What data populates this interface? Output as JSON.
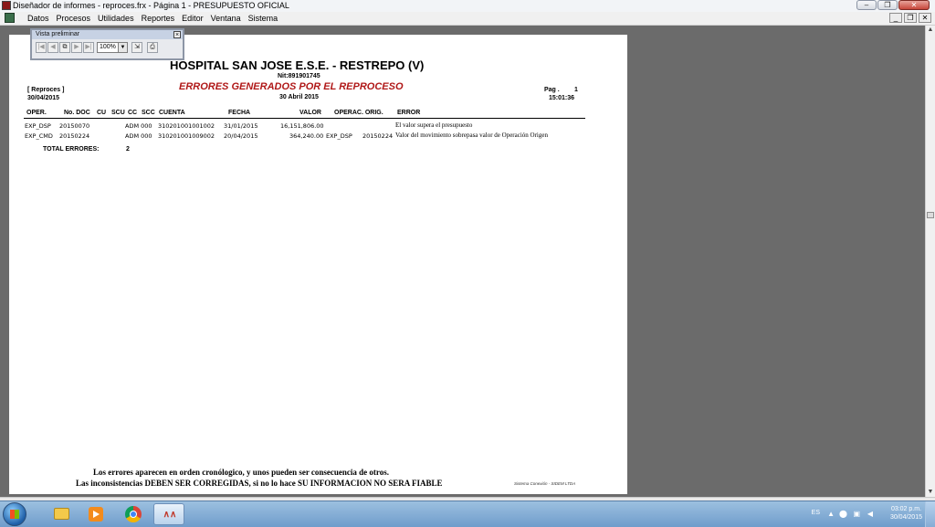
{
  "window": {
    "title": "Diseñador de informes - reproces.frx - Página 1 - PRESUPUESTO OFICIAL",
    "controls": {
      "minimize": "–",
      "restore": "❐",
      "close": "✕"
    }
  },
  "menu": {
    "items": [
      "Datos",
      "Procesos",
      "Utilidades",
      "Reportes",
      "Editor",
      "Ventana",
      "Sistema"
    ],
    "mdi_controls": {
      "minimize": "_",
      "restore": "❐",
      "close": "✕"
    }
  },
  "preview_toolbar": {
    "title": "Vista preliminar",
    "close": "×",
    "buttons": {
      "first": "|◀",
      "prev": "◀",
      "goto": "⧉",
      "next": "▶",
      "last": "▶|"
    },
    "zoom_value": "100%",
    "zoom_dropdown": "▼",
    "print_icon_glyph": "⎙",
    "exit_icon_glyph": "⇲"
  },
  "report": {
    "title": "HOSPITAL SAN JOSE E.S.E. - RESTREPO (V)",
    "nit": "Nit:891901745",
    "subtitle": "ERRORES GENERADOS POR EL REPROCESO",
    "report_date": "30 Abril 2015",
    "module": "[ Reproces ]",
    "print_date": "30/04/2015",
    "page_label": "Pag .",
    "page_number": "1",
    "time": "15:01:36",
    "columns": [
      "OPER.",
      "No. DOC",
      "CU",
      "SCU",
      "CC",
      "SCC",
      "CUENTA",
      "FECHA",
      "VALOR",
      "OPERAC. ORIG.",
      "ERROR"
    ],
    "rows": [
      {
        "oper": "EXP_DSP",
        "doc": "20150070",
        "adm": "ADM 000",
        "cuenta": "310201001001002",
        "fecha": "31/01/2015",
        "valor": "16,151,806.00",
        "oper_orig": "",
        "doc_orig": "",
        "error": "El valor supera el presupuesto"
      },
      {
        "oper": "EXP_CMD",
        "doc": "20150224",
        "adm": "ADM 000",
        "cuenta": "310201001009002",
        "fecha": "20/04/2015",
        "valor": "364,240.00",
        "oper_orig": "EXP_DSP",
        "doc_orig": "20150224",
        "error": "Valor del movimiento sobrepasa valor de Operación Origen"
      }
    ],
    "total_label": "TOTAL ERRORES:",
    "total_value": "2",
    "footer_line1": "Los errores aparecen en orden cronólogico, y unos pueden ser consecuencia de otros.",
    "footer_line2": "Las inconsistencias DEBEN SER CORREGIDAS, si no lo hace SU INFORMACION NO SERA FIABLE",
    "footer_credit": "Sistema Conexión - SIDEM LTDA"
  },
  "scrollbar": {
    "up": "▲",
    "down": "▼"
  },
  "taskbar": {
    "apps": [
      "folder-icon",
      "media-player-icon",
      "chrome-icon",
      "report-designer-icon"
    ],
    "tray": {
      "language": "ES",
      "expand": "▲",
      "time": "03:02 p.m.",
      "date": "30/04/2015"
    }
  },
  "colors": {
    "subtitle_red": "#b01818",
    "workspace_gray": "#6b6b6b",
    "taskbar_blue": "#6f9ccb"
  }
}
